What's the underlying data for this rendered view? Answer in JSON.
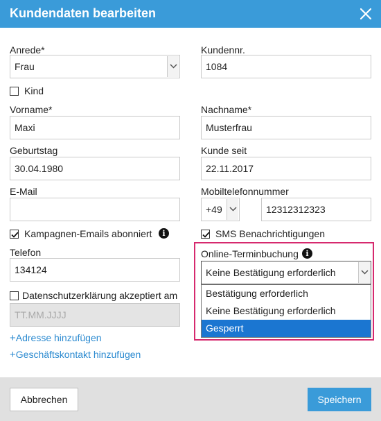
{
  "dialog": {
    "title": "Kundendaten bearbeiten"
  },
  "colors": {
    "titlebar": "#3a9bd9",
    "primary_button": "#3a9bd9",
    "highlight_border": "#d6296e",
    "selected_option": "#1b76d1",
    "link": "#2b8ad0"
  },
  "icons": {
    "close": "close-icon",
    "checkmark": "checkmark-icon",
    "info": "info-icon",
    "chevron": "chevron-down-icon",
    "plus": "plus-icon"
  },
  "form": {
    "anrede": {
      "label": "Anrede*",
      "value": "Frau"
    },
    "kundennr": {
      "label": "Kundennr.",
      "value": "1084"
    },
    "kind": {
      "label": "Kind",
      "checked": false
    },
    "vorname": {
      "label": "Vorname*",
      "value": "Maxi"
    },
    "nachname": {
      "label": "Nachname*",
      "value": "Musterfrau"
    },
    "geburtstag": {
      "label": "Geburtstag",
      "value": "30.04.1980"
    },
    "kunde_seit": {
      "label": "Kunde seit",
      "value": "22.11.2017"
    },
    "email": {
      "label": "E-Mail",
      "value": ""
    },
    "mobil": {
      "label": "Mobiltelefonnummer",
      "prefix": "+49",
      "value": "12312312323"
    },
    "kampagnen": {
      "label": "Kampagnen-Emails abonniert",
      "checked": true,
      "info": "i"
    },
    "sms": {
      "label": "SMS Benachrichtigungen",
      "checked": true
    },
    "telefon": {
      "label": "Telefon",
      "value": "134124"
    },
    "online_termin": {
      "label": "Online-Terminbuchung",
      "info": "i",
      "value": "Keine Bestätigung erforderlich",
      "options": [
        "Bestätigung erforderlich",
        "Keine Bestätigung erforderlich",
        "Gesperrt"
      ],
      "highlighted_option": "Gesperrt"
    },
    "datenschutz": {
      "label": "Datenschutzerklärung akzeptiert am",
      "checked": false,
      "placeholder": "TT.MM.JJJJ"
    }
  },
  "links": {
    "plus": "+",
    "adresse": "Adresse hinzufügen",
    "geschaeftskontakt": "Geschäftskontakt hinzufügen"
  },
  "footer": {
    "cancel_label": "Abbrechen",
    "save_label": "Speichern"
  }
}
